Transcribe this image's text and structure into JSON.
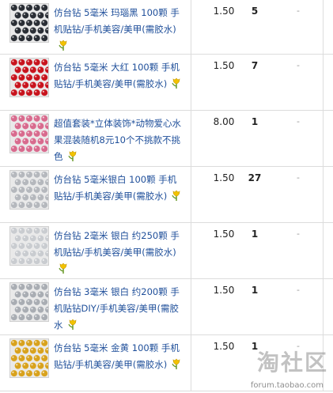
{
  "items": [
    {
      "title": "仿台钻 5毫米 玛瑙黑 100颗 手机贴钻/手机美容/美甲(需胶水)",
      "price": "1.50",
      "qty": "5",
      "dash": "-",
      "thumb_color": "#2a2e35"
    },
    {
      "title": "仿台钻 5毫米 大红 100颗 手机贴钻/手机美容/美甲(需胶水)",
      "price": "1.50",
      "qty": "7",
      "dash": "-",
      "thumb_color": "#c8141e"
    },
    {
      "title": "超值套装*立体装饰*动物爱心水果混装随机8元10个不挑款不挑色",
      "price": "8.00",
      "qty": "1",
      "dash": "-",
      "thumb_color": "#d86b8e"
    },
    {
      "title": "仿台钻 5毫米银白 100颗 手机贴钻/手机美容/美甲(需胶水)",
      "price": "1.50",
      "qty": "27",
      "dash": "-",
      "thumb_color": "#b5b8bd"
    },
    {
      "title": "仿台钻 2毫米 银白 约250颗 手机贴钻/手机美容/美甲(需胶水)",
      "price": "1.50",
      "qty": "1",
      "dash": "-",
      "thumb_color": "#c9ccd0"
    },
    {
      "title": "仿台钻 3毫米 银白 约200颗 手机贴钻DIY/手机美容/美甲(需胶水",
      "price": "1.50",
      "qty": "1",
      "dash": "-",
      "thumb_color": "#a9adb3"
    },
    {
      "title": "仿台钻 5毫米 金黄 100颗 手机贴钻/手机美容/美甲(需胶水)",
      "price": "1.50",
      "qty": "1",
      "dash": "-",
      "thumb_color": "#d8a21e"
    }
  ],
  "watermark": {
    "brand": "淘社区",
    "url": "forum.taobao.com"
  },
  "colors": {
    "link": "#1f4f9a",
    "border": "#dcdcdc"
  }
}
